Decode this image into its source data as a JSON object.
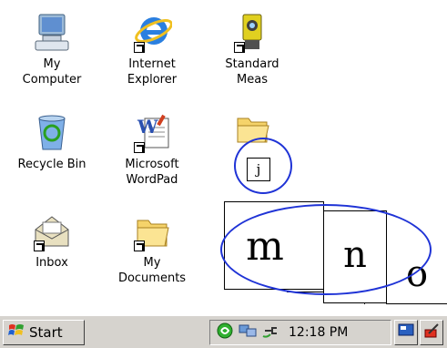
{
  "desktop": {
    "icons": {
      "my_computer": {
        "label": "My\nComputer",
        "icon": "my-computer-icon"
      },
      "internet_explorer": {
        "label": "Internet\nExplorer",
        "icon": "internet-explorer-icon"
      },
      "standard_meas": {
        "label": "Standard\nMeas",
        "icon": "total-station-icon"
      },
      "recycle_bin": {
        "label": "Recycle Bin",
        "icon": "recycle-bin-icon"
      },
      "wordpad": {
        "label": "Microsoft\nWordPad",
        "icon": "wordpad-icon"
      },
      "folder_j": {
        "label": "",
        "icon": "folder-icon"
      },
      "inbox": {
        "label": "Inbox",
        "icon": "inbox-icon"
      },
      "my_documents": {
        "label": "My\nDocuments",
        "icon": "folder-icon"
      }
    }
  },
  "overlay": {
    "keys": [
      "j",
      "m",
      "n",
      "o"
    ],
    "circle_color": "#1f33d6"
  },
  "taskbar": {
    "start_label": "Start",
    "clock": "12:18 PM",
    "tray_icons": [
      "connection-icon",
      "network-icon",
      "power-icon"
    ],
    "quick_buttons": [
      "desktop-icon",
      "input-panel-icon"
    ]
  }
}
